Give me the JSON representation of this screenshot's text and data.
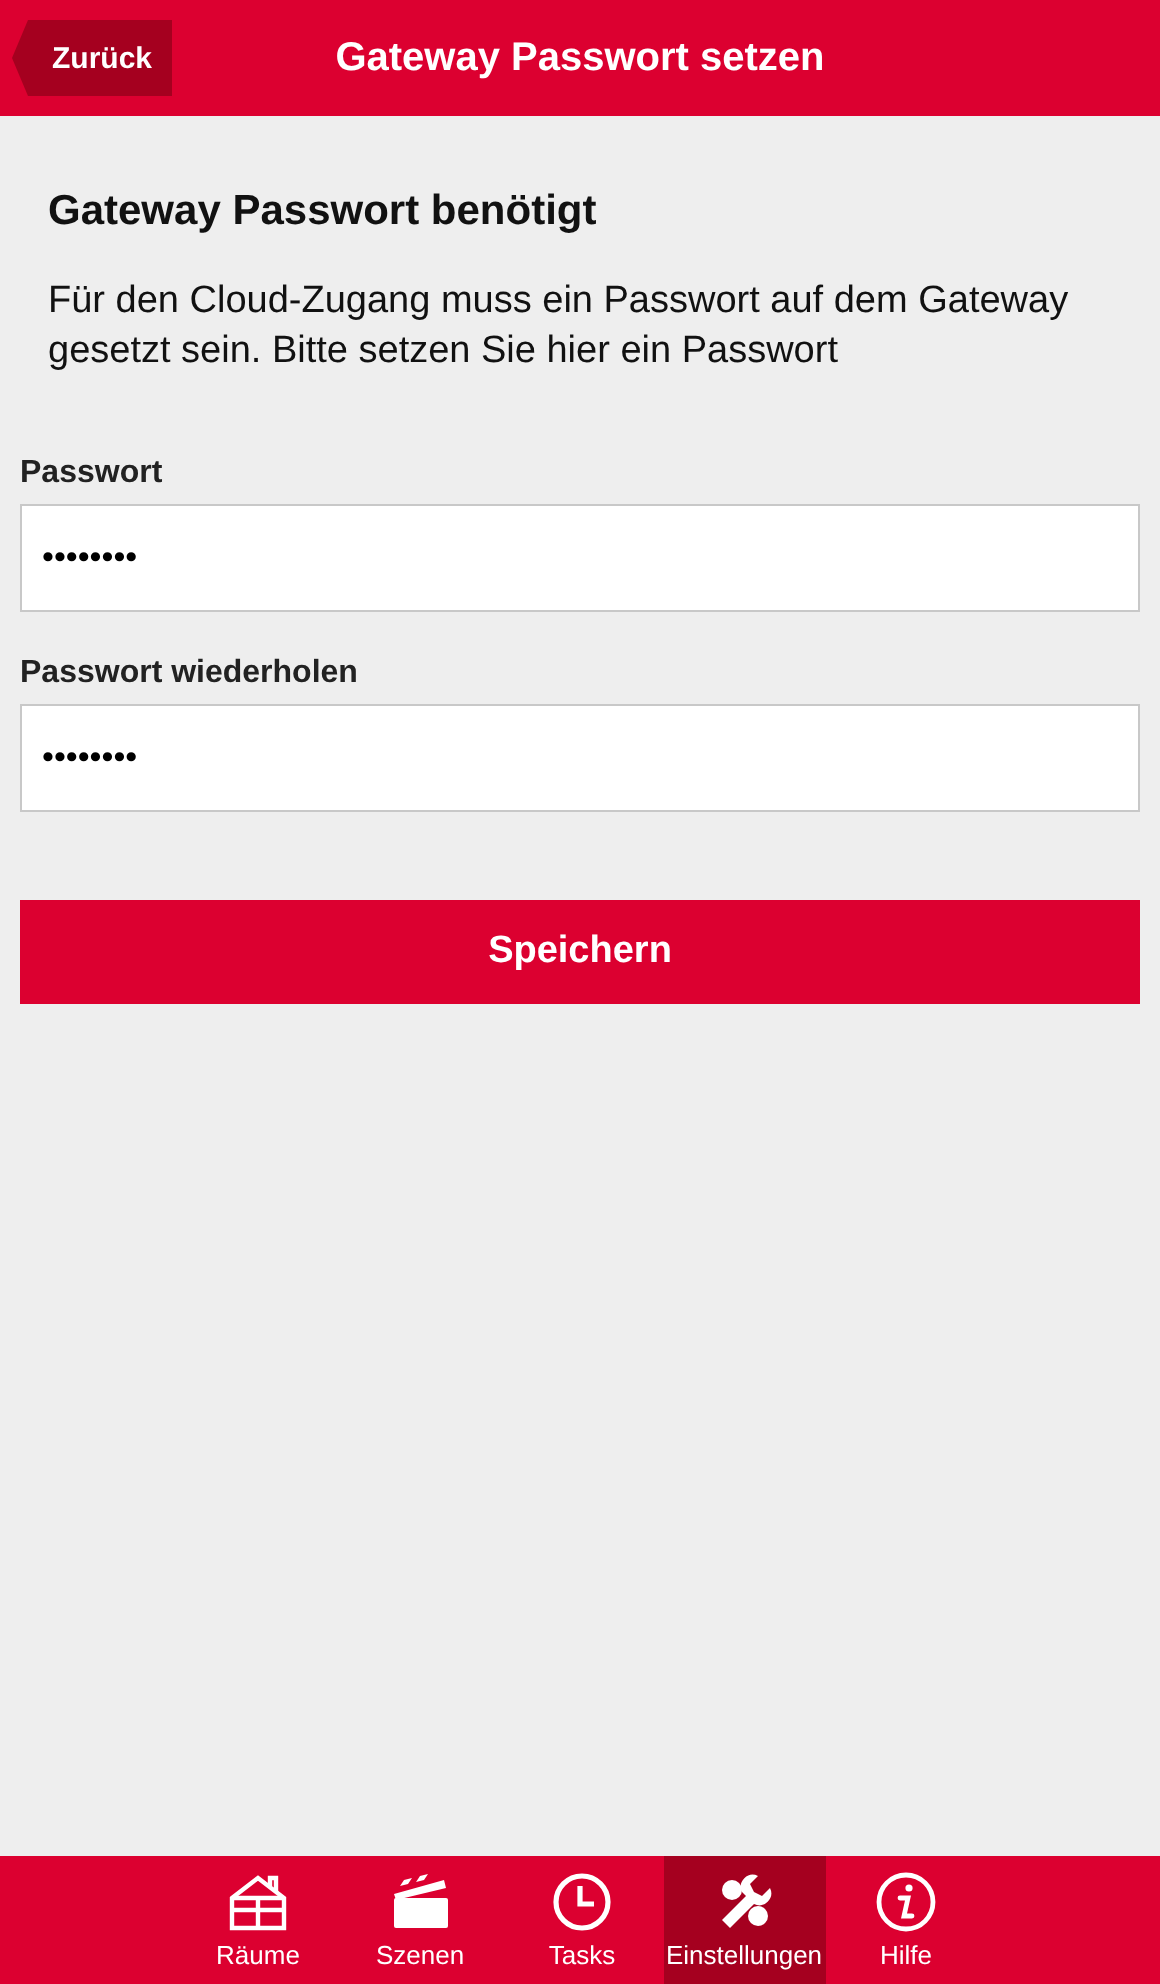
{
  "header": {
    "back_button": "Zurück",
    "title": "Gateway Passwort setzen"
  },
  "content": {
    "heading": "Gateway Passwort benötigt",
    "text": "Für den Cloud-Zugang muss ein Passwort auf dem Gateway gesetzt sein. Bitte setzen Sie hier ein Passwort",
    "fields": [
      {
        "label": "Passwort",
        "value": "••••••••"
      },
      {
        "label": "Passwort wiederholen",
        "value": "••••••••"
      }
    ],
    "save_button": "Speichern"
  },
  "tab_bar": [
    {
      "kind": "rooms",
      "label": "Räume",
      "selected": false
    },
    {
      "kind": "scenes",
      "label": "Szenen",
      "selected": false
    },
    {
      "kind": "tasks",
      "label": "Tasks",
      "selected": false
    },
    {
      "kind": "settings",
      "label": "Einstellungen",
      "selected": true
    },
    {
      "kind": "help",
      "label": "Hilfe",
      "selected": false
    }
  ]
}
